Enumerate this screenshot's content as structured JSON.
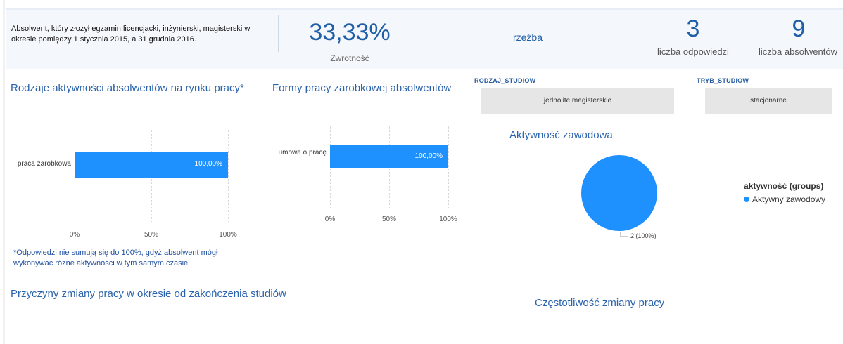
{
  "header": {
    "description": "Absolwent, który złożył egzamin licencjacki, inżynierski, magisterski w okresie pomiędzy 1  stycznia 2015, a 31 grudnia 2016.",
    "response_rate": "33,33%",
    "response_rate_label": "Zwrotność",
    "field": "rzeźba",
    "responses_count": "3",
    "responses_label": "liczba odpowiedzi",
    "graduates_count": "9",
    "graduates_label": "liczba absolwentów"
  },
  "slicers": {
    "rodzaj_title": "RODZAJ_STUDIOW",
    "rodzaj_value": "jednolite magisterskie",
    "tryb_title": "TRYB_STUDIOW",
    "tryb_value": "stacjonarne"
  },
  "footnote": "*Odpowiedzi nie sumują się do 100%, gdyż absolwent mógł wykonywać różne aktywnosci w tym samym czasie",
  "sections": {
    "reasons_title": "Przyczyny zmiany pracy w okresie od zakończenia studiów",
    "frequency_title": "Częstotliwość zmiany pracy"
  },
  "chart_data": [
    {
      "type": "bar",
      "orientation": "horizontal",
      "title": "Rodzaje aktywności absolwentów na rynku pracy*",
      "categories": [
        "praca zarobkowa"
      ],
      "values": [
        100
      ],
      "value_labels": [
        "100,00%"
      ],
      "xlim": [
        0,
        100
      ],
      "xticks": [
        "0%",
        "50%",
        "100%"
      ],
      "color": "#1f91ff",
      "grid": true
    },
    {
      "type": "bar",
      "orientation": "horizontal",
      "title": "Formy pracy zarobkowej absolwentów",
      "categories": [
        "umowa o pracę"
      ],
      "values": [
        100
      ],
      "value_labels": [
        "100,00%"
      ],
      "xlim": [
        0,
        100
      ],
      "xticks": [
        "0%",
        "50%",
        "100%"
      ],
      "color": "#1f91ff",
      "grid": true
    },
    {
      "type": "pie",
      "title": "Aktywność zawodowa",
      "legend_title": "aktywność (groups)",
      "legend_position": "right",
      "slices": [
        {
          "label": "Aktywny zawodowy",
          "value": 2,
          "data_label": "2 (100%)",
          "color": "#1f91ff"
        }
      ]
    }
  ]
}
